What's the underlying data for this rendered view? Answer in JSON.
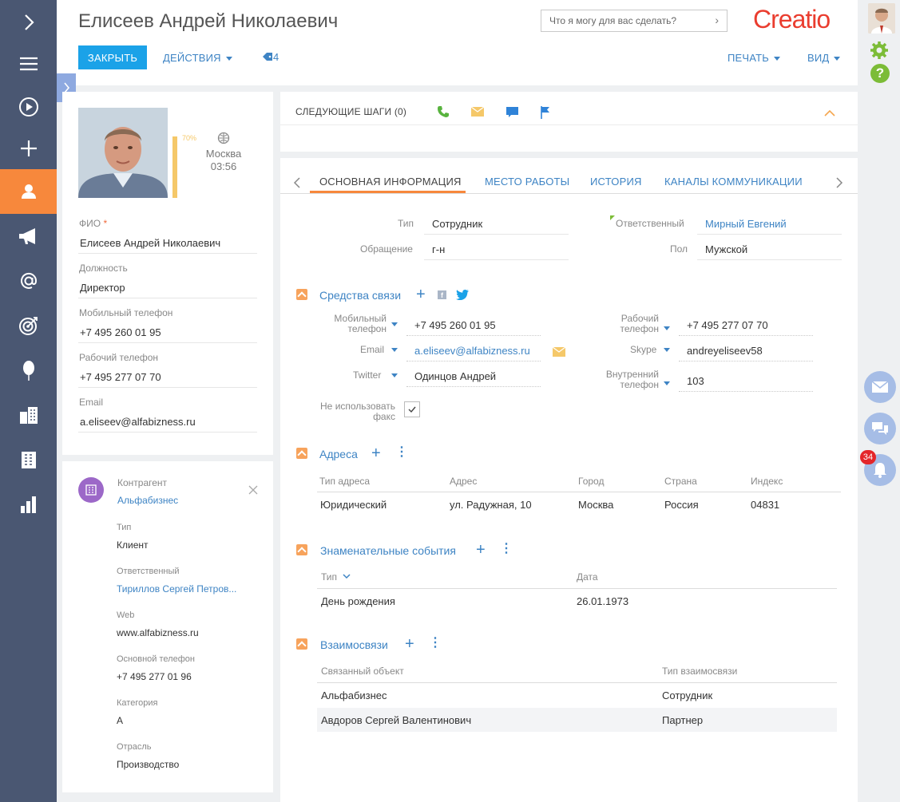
{
  "header": {
    "title": "Елисеев Андрей Николаевич",
    "close_label": "ЗАКРЫТЬ",
    "actions_label": "ДЕЙСТВИЯ",
    "tags_count": "4",
    "print_label": "ПЕЧАТЬ",
    "view_label": "ВИД",
    "search_placeholder": "Что я могу для вас сделать?",
    "logo": "Creatio"
  },
  "profile": {
    "completeness": "70%",
    "city": "Москва",
    "time": "03:56",
    "fields": [
      {
        "label": "ФИО",
        "value": "Елисеев Андрей Николаевич",
        "required": "*"
      },
      {
        "label": "Должность",
        "value": "Директор"
      },
      {
        "label": "Мобильный телефон",
        "value": "+7 495 260 01 95"
      },
      {
        "label": "Рабочий телефон",
        "value": "+7 495 277 07 70"
      },
      {
        "label": "Email",
        "value": "a.eliseev@alfabizness.ru"
      }
    ]
  },
  "account": {
    "label": "Контрагент",
    "name": "Альфабизнес",
    "fields": [
      {
        "label": "Тип",
        "value": "Клиент"
      },
      {
        "label": "Ответственный",
        "value": "Тириллов Сергей Петров..."
      },
      {
        "label": "Web",
        "value": "www.alfabizness.ru"
      },
      {
        "label": "Основной телефон",
        "value": "+7 495 277 01 96"
      },
      {
        "label": "Категория",
        "value": "A"
      },
      {
        "label": "Отрасль",
        "value": "Производство"
      }
    ]
  },
  "next_steps": {
    "label": "СЛЕДУЮЩИЕ ШАГИ (0)"
  },
  "tabs": [
    "ОСНОВНАЯ ИНФОРМАЦИЯ",
    "МЕСТО РАБОТЫ",
    "ИСТОРИЯ",
    "КАНАЛЫ  КОММУНИКАЦИИ"
  ],
  "main": {
    "type_label": "Тип",
    "type_value": "Сотрудник",
    "salutation_label": "Обращение",
    "salutation_value": "г-н",
    "owner_label": "Ответственный",
    "owner_value": "Мирный Евгений",
    "gender_label": "Пол",
    "gender_value": "Мужской"
  },
  "comm": {
    "title": "Средства связи",
    "mobile_label": "Мобильный телефон",
    "mobile_value": "+7 495 260 01 95",
    "email_label": "Email",
    "email_value": "a.eliseev@alfabizness.ru",
    "twitter_label": "Twitter",
    "twitter_value": "Одинцов Андрей",
    "work_label": "Рабочий телефон",
    "work_value": "+7 495 277 07 70",
    "skype_label": "Skype",
    "skype_value": "andreyeliseev58",
    "internal_label": "Внутренний телефон",
    "internal_value": "103",
    "nofax_label": "Не использовать факс"
  },
  "addresses": {
    "title": "Адреса",
    "headers": [
      "Тип адреса",
      "Адрес",
      "Город",
      "Страна",
      "Индекс"
    ],
    "row": [
      "Юридический",
      "ул. Радужная, 10",
      "Москва",
      "Россия",
      "04831"
    ]
  },
  "events": {
    "title": "Знаменательные события",
    "headers": [
      "Тип",
      "Дата"
    ],
    "row": [
      "День рождения",
      "26.01.1973"
    ]
  },
  "relations": {
    "title": "Взаимосвязи",
    "headers": [
      "Связанный объект",
      "Тип взаимосвязи"
    ],
    "rows": [
      [
        "Альфабизнес",
        "Сотрудник"
      ],
      [
        "Авдоров Сергей Валентинович",
        "Партнер"
      ]
    ]
  },
  "notifications": {
    "count": "34"
  },
  "colors": {
    "accent": "#1ba2e8",
    "nav": "#4a5772",
    "active": "#f7883c",
    "link": "#3e84c4"
  }
}
